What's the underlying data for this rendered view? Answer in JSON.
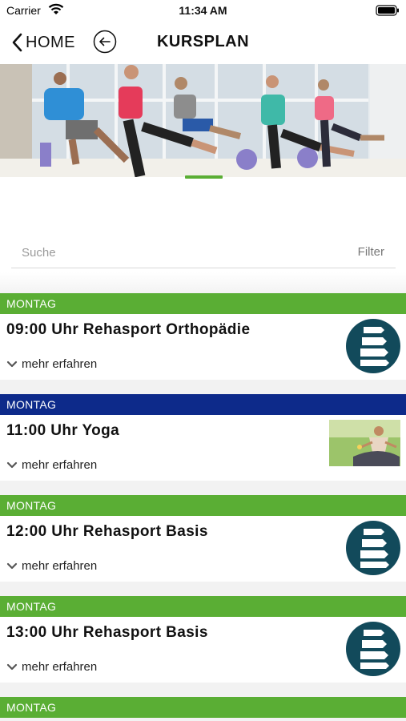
{
  "status_bar": {
    "carrier": "Carrier",
    "time": "11:34 AM"
  },
  "header": {
    "back_label": "HOME",
    "title": "KURSPLAN"
  },
  "search": {
    "placeholder": "Suche",
    "filter_label": "Filter"
  },
  "colors": {
    "green": "#5aae34",
    "blue": "#0d2a8a",
    "icon_teal": "#124a5b"
  },
  "courses": [
    {
      "day": "MONTAG",
      "title": "09:00 Uhr Rehasport Orthopädie",
      "more": "mehr erfahren",
      "day_color": "green",
      "image": "spine-icon"
    },
    {
      "day": "MONTAG",
      "title": "11:00 Uhr Yoga",
      "more": "mehr erfahren",
      "day_color": "blue",
      "image": "yoga-photo"
    },
    {
      "day": "MONTAG",
      "title": "12:00 Uhr Rehasport Basis",
      "more": "mehr erfahren",
      "day_color": "green",
      "image": "spine-icon"
    },
    {
      "day": "MONTAG",
      "title": "13:00 Uhr Rehasport Basis",
      "more": "mehr erfahren",
      "day_color": "green",
      "image": "spine-icon"
    },
    {
      "day": "MONTAG",
      "day_color": "green"
    }
  ]
}
